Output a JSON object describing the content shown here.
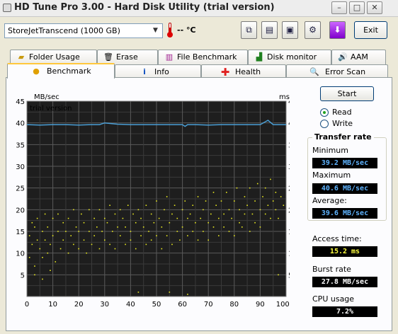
{
  "window": {
    "title": "HD Tune Pro 3.00 - Hard Disk Utility (trial version)"
  },
  "toolbar": {
    "drive": "StoreJetTranscend  (1000 GB)",
    "temperature": "-- °C",
    "exit_label": "Exit"
  },
  "tabs_back": [
    {
      "label": "Folder Usage",
      "icon": "folder-icon"
    },
    {
      "label": "Erase",
      "icon": "trash-icon"
    },
    {
      "label": "File Benchmark",
      "icon": "file-benchmark-icon"
    },
    {
      "label": "Disk monitor",
      "icon": "disk-monitor-icon"
    },
    {
      "label": "AAM",
      "icon": "speaker-icon"
    }
  ],
  "tabs_front": [
    {
      "label": "Benchmark",
      "icon": "benchmark-icon",
      "active": true
    },
    {
      "label": "Info",
      "icon": "info-icon"
    },
    {
      "label": "Health",
      "icon": "health-cross-icon"
    },
    {
      "label": "Error Scan",
      "icon": "magnifier-icon"
    }
  ],
  "controls": {
    "start_label": "Start",
    "read_label": "Read",
    "write_label": "Write",
    "selected_mode": "Read"
  },
  "stats": {
    "transfer_rate_title": "Transfer rate",
    "minimum_label": "Minimum",
    "minimum_value": "39.2 MB/sec",
    "maximum_label": "Maximum",
    "maximum_value": "40.6 MB/sec",
    "average_label": "Average:",
    "average_value": "39.6 MB/sec",
    "access_time_label": "Access time:",
    "access_time_value": "15.2 ms",
    "burst_rate_label": "Burst rate",
    "burst_rate_value": "27.8 MB/sec",
    "cpu_usage_label": "CPU usage",
    "cpu_usage_value": "7.2%"
  },
  "colors": {
    "plot_background": "#1e1e1e",
    "grid": "#5a5a5a",
    "transfer_line": "#4a9fd6",
    "access_points": "#e8e820",
    "watermark": "#c8c8c8"
  },
  "chart_data": {
    "type": "line",
    "watermark": "trial version",
    "y_left_label": "MB/sec",
    "y_right_label": "ms",
    "ylim": [
      0,
      45
    ],
    "y_ticks": [
      5,
      10,
      15,
      20,
      25,
      30,
      35,
      40,
      45
    ],
    "xlim": [
      0,
      100
    ],
    "x_ticks": [
      "0",
      "10",
      "20",
      "30",
      "40",
      "50",
      "60",
      "70",
      "80",
      "90",
      "100%"
    ],
    "grid": true,
    "series": [
      {
        "kind": "line",
        "x": [
          0,
          5,
          10,
          15,
          20,
          25,
          28,
          30,
          35,
          40,
          45,
          50,
          55,
          60,
          61,
          62,
          65,
          70,
          75,
          80,
          85,
          90,
          93,
          95,
          100
        ],
        "values": [
          39.6,
          39.5,
          39.6,
          39.6,
          39.5,
          39.6,
          39.6,
          40.0,
          39.7,
          39.6,
          39.6,
          39.6,
          39.6,
          39.6,
          39.2,
          39.6,
          39.6,
          39.5,
          39.6,
          39.6,
          39.6,
          39.6,
          40.6,
          39.6,
          39.6
        ]
      },
      {
        "kind": "scatter",
        "points": [
          [
            1,
            14
          ],
          [
            1,
            9
          ],
          [
            2,
            17
          ],
          [
            2,
            12
          ],
          [
            3,
            16
          ],
          [
            3,
            7
          ],
          [
            4,
            13
          ],
          [
            4,
            18
          ],
          [
            5,
            11
          ],
          [
            6,
            15
          ],
          [
            6,
            9
          ],
          [
            7,
            19
          ],
          [
            7,
            13
          ],
          [
            8,
            10
          ],
          [
            8,
            16
          ],
          [
            9,
            12
          ],
          [
            10,
            18
          ],
          [
            10,
            14
          ],
          [
            11,
            8
          ],
          [
            12,
            15
          ],
          [
            12,
            19
          ],
          [
            13,
            11
          ],
          [
            14,
            17
          ],
          [
            14,
            13
          ],
          [
            15,
            15
          ],
          [
            16,
            10
          ],
          [
            16,
            18
          ],
          [
            17,
            14
          ],
          [
            18,
            12
          ],
          [
            18,
            20
          ],
          [
            19,
            16
          ],
          [
            20,
            11
          ],
          [
            20,
            15
          ],
          [
            21,
            19
          ],
          [
            22,
            13
          ],
          [
            22,
            17
          ],
          [
            23,
            10
          ],
          [
            24,
            15
          ],
          [
            24,
            20
          ],
          [
            25,
            12
          ],
          [
            26,
            18
          ],
          [
            26,
            14
          ],
          [
            27,
            16
          ],
          [
            28,
            11
          ],
          [
            28,
            20
          ],
          [
            29,
            15
          ],
          [
            30,
            13
          ],
          [
            30,
            18
          ],
          [
            31,
            17
          ],
          [
            32,
            12
          ],
          [
            32,
            21
          ],
          [
            33,
            15
          ],
          [
            34,
            19
          ],
          [
            34,
            11
          ],
          [
            35,
            16
          ],
          [
            36,
            14
          ],
          [
            36,
            20
          ],
          [
            37,
            18
          ],
          [
            38,
            12
          ],
          [
            38,
            16
          ],
          [
            39,
            21
          ],
          [
            40,
            15
          ],
          [
            40,
            13
          ],
          [
            41,
            19
          ],
          [
            42,
            17
          ],
          [
            42,
            11
          ],
          [
            43,
            20
          ],
          [
            44,
            14
          ],
          [
            44,
            18
          ],
          [
            45,
            16
          ],
          [
            46,
            12
          ],
          [
            46,
            21
          ],
          [
            47,
            15
          ],
          [
            48,
            19
          ],
          [
            48,
            13
          ],
          [
            49,
            17
          ],
          [
            50,
            22
          ],
          [
            50,
            14
          ],
          [
            51,
            18
          ],
          [
            52,
            11
          ],
          [
            52,
            16
          ],
          [
            53,
            20
          ],
          [
            54,
            14
          ],
          [
            54,
            23
          ],
          [
            55,
            17
          ],
          [
            56,
            12
          ],
          [
            56,
            19
          ],
          [
            57,
            21
          ],
          [
            58,
            15
          ],
          [
            58,
            18
          ],
          [
            59,
            13
          ],
          [
            60,
            20
          ],
          [
            60,
            16
          ],
          [
            61,
            22
          ],
          [
            62,
            14
          ],
          [
            62,
            18
          ],
          [
            63,
            19
          ],
          [
            64,
            15
          ],
          [
            64,
            21
          ],
          [
            65,
            17
          ],
          [
            66,
            13
          ],
          [
            66,
            23
          ],
          [
            67,
            18
          ],
          [
            68,
            20
          ],
          [
            68,
            15
          ],
          [
            69,
            22
          ],
          [
            70,
            17
          ],
          [
            70,
            13
          ],
          [
            71,
            19
          ],
          [
            72,
            24
          ],
          [
            72,
            16
          ],
          [
            73,
            21
          ],
          [
            74,
            14
          ],
          [
            74,
            18
          ],
          [
            75,
            22
          ],
          [
            76,
            16
          ],
          [
            76,
            19
          ],
          [
            77,
            24
          ],
          [
            78,
            15
          ],
          [
            78,
            20
          ],
          [
            79,
            18
          ],
          [
            80,
            22
          ],
          [
            80,
            14
          ],
          [
            81,
            25
          ],
          [
            82,
            17
          ],
          [
            82,
            20
          ],
          [
            83,
            16
          ],
          [
            84,
            23
          ],
          [
            84,
            19
          ],
          [
            85,
            21
          ],
          [
            86,
            15
          ],
          [
            86,
            25
          ],
          [
            87,
            19
          ],
          [
            88,
            22
          ],
          [
            88,
            17
          ],
          [
            89,
            26
          ],
          [
            90,
            20
          ],
          [
            90,
            16
          ],
          [
            91,
            23
          ],
          [
            92,
            19
          ],
          [
            92,
            25
          ],
          [
            93,
            21
          ],
          [
            94,
            18
          ],
          [
            94,
            27
          ],
          [
            95,
            22
          ],
          [
            96,
            20
          ],
          [
            96,
            24
          ],
          [
            97,
            18
          ],
          [
            98,
            23
          ],
          [
            99,
            21
          ],
          [
            3,
            5
          ],
          [
            6,
            4
          ],
          [
            9,
            6
          ],
          [
            43,
            1
          ],
          [
            55,
            1
          ],
          [
            62,
            0.5
          ],
          [
            97,
            5
          ]
        ]
      }
    ]
  }
}
